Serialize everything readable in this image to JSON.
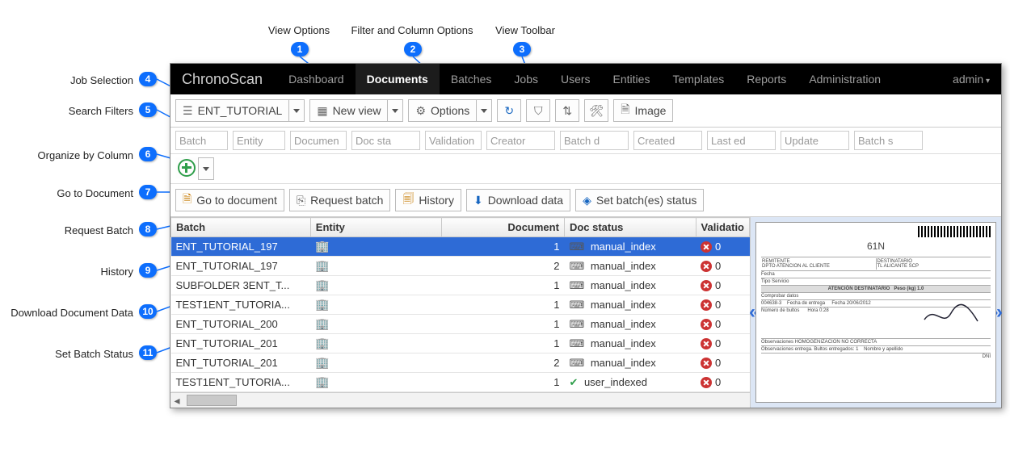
{
  "callouts_top": [
    {
      "n": 1,
      "label": "View Options"
    },
    {
      "n": 2,
      "label": "Filter and Column Options"
    },
    {
      "n": 3,
      "label": "View Toolbar"
    }
  ],
  "callouts_left": [
    {
      "n": 4,
      "label": "Job Selection"
    },
    {
      "n": 5,
      "label": "Search Filters"
    },
    {
      "n": 6,
      "label": "Organize by Column"
    },
    {
      "n": 7,
      "label": "Go to Document"
    },
    {
      "n": 8,
      "label": "Request Batch"
    },
    {
      "n": 9,
      "label": "History"
    },
    {
      "n": 10,
      "label": "Download Document Data"
    },
    {
      "n": 11,
      "label": "Set Batch Status"
    }
  ],
  "app": {
    "brand": "ChronoScan",
    "nav": [
      "Dashboard",
      "Documents",
      "Batches",
      "Jobs",
      "Users",
      "Entities",
      "Templates",
      "Reports",
      "Administration"
    ],
    "nav_active": "Documents",
    "user": "admin"
  },
  "toolstrip": {
    "jobselect": "ENT_TUTORIAL",
    "view_btn": "New view",
    "options_btn": "Options",
    "image_btn": "Image"
  },
  "filters": [
    "Batch",
    "Entity",
    "Documen",
    "Doc sta",
    "Validation",
    "Creator",
    "Batch d",
    "Created",
    "Last ed",
    "Update",
    "Batch s"
  ],
  "actions": {
    "go": "Go to document",
    "request": "Request batch",
    "history": "History",
    "download": "Download data",
    "setstatus": "Set batch(es) status"
  },
  "table": {
    "cols": [
      "Batch",
      "Entity",
      "Document",
      "Doc status",
      "Validatio"
    ],
    "rows": [
      {
        "batch": "ENT_TUTORIAL_197",
        "entity_icon": true,
        "doc": 1,
        "status": "manual_index",
        "val": "0",
        "sel": true
      },
      {
        "batch": "ENT_TUTORIAL_197",
        "entity_icon": true,
        "doc": 2,
        "status": "manual_index",
        "val": "0"
      },
      {
        "batch": "SUBFOLDER 3ENT_T...",
        "entity_icon": true,
        "doc": 1,
        "status": "manual_index",
        "val": "0"
      },
      {
        "batch": "TEST1ENT_TUTORIA...",
        "entity_icon": true,
        "doc": 1,
        "status": "manual_index",
        "val": "0"
      },
      {
        "batch": "ENT_TUTORIAL_200",
        "entity_icon": true,
        "doc": 1,
        "status": "manual_index",
        "val": "0"
      },
      {
        "batch": "ENT_TUTORIAL_201",
        "entity_icon": true,
        "doc": 1,
        "status": "manual_index",
        "val": "0"
      },
      {
        "batch": "ENT_TUTORIAL_201",
        "entity_icon": true,
        "doc": 2,
        "status": "manual_index",
        "val": "0"
      },
      {
        "batch": "TEST1ENT_TUTORIA...",
        "entity_icon": true,
        "doc": 1,
        "status": "user_indexed",
        "val": "0",
        "user": true
      }
    ]
  },
  "preview": {
    "title": "61N"
  }
}
